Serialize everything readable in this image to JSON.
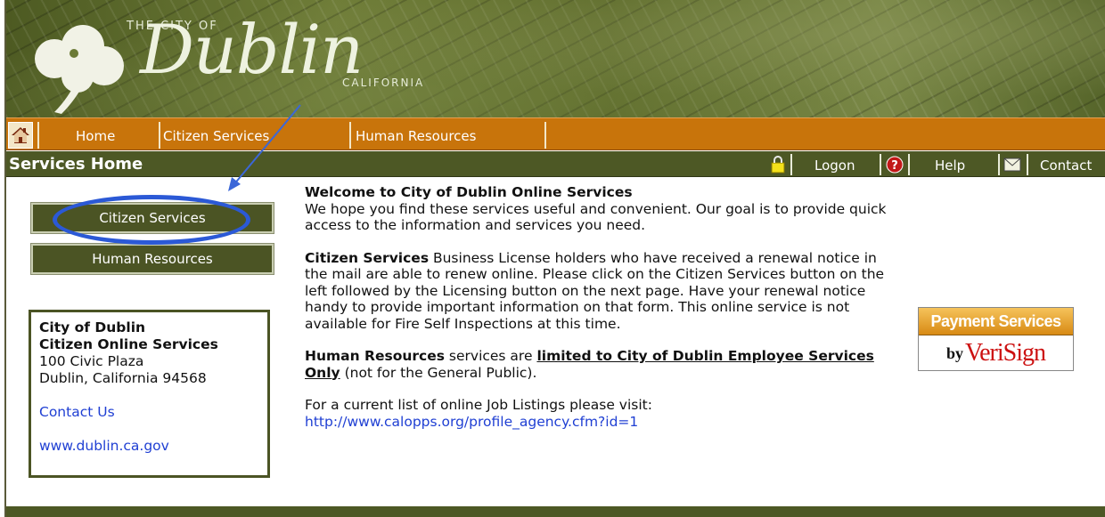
{
  "banner": {
    "city_of": "THE CITY OF",
    "city_name": "Dublin",
    "state": "CALIFORNIA"
  },
  "nav": {
    "home_icon": "home-icon",
    "items": [
      {
        "label": "Home"
      },
      {
        "label": "Citizen Services"
      },
      {
        "label": "Human Resources"
      }
    ]
  },
  "titlebar": {
    "page_title": "Services Home",
    "actions": [
      {
        "icon": "lock-icon",
        "label": "Logon"
      },
      {
        "icon": "help-icon",
        "label": "Help"
      },
      {
        "icon": "envelope-icon",
        "label": "Contact"
      }
    ]
  },
  "sidebar": {
    "buttons": [
      {
        "label": "Citizen Services"
      },
      {
        "label": "Human Resources"
      }
    ],
    "address": {
      "org": "City of Dublin",
      "dept": "Citizen Online Services",
      "street": "100 Civic Plaza",
      "city": "Dublin, California 94568",
      "contact_link": "Contact Us",
      "website_link": "www.dublin.ca.gov"
    }
  },
  "main": {
    "welcome_title": "Welcome to City of Dublin Online Services",
    "welcome_text": "We hope you find these services useful and convenient. Our goal is to provide quick access to the information and services you need.",
    "citizen_heading": "Citizen Services",
    "citizen_text": " Business License holders who have received a renewal notice in the mail are able to renew online. Please click on the Citizen Services button on the left followed by the Licensing button on the next page. Have your renewal notice handy to provide important information on that form. This online service is not available for Fire Self Inspections at this time.",
    "hr_heading": "Human Resources",
    "hr_text_1": " services are ",
    "hr_limited": "limited to City of Dublin Employee Services Only",
    "hr_text_2": " (not for the General Public).",
    "jobs_text": "For a current list of online Job Listings please visit:",
    "jobs_link": "http://www.calopps.org/profile_agency.cfm?id=1"
  },
  "payment_badge": {
    "top": "Payment Services",
    "by": "by",
    "brand": "VeriSign"
  },
  "colors": {
    "nav_orange": "#c8740b",
    "bar_green": "#4d5825",
    "link_blue": "#1f3fd3",
    "annotation_blue": "#2b59d6"
  }
}
